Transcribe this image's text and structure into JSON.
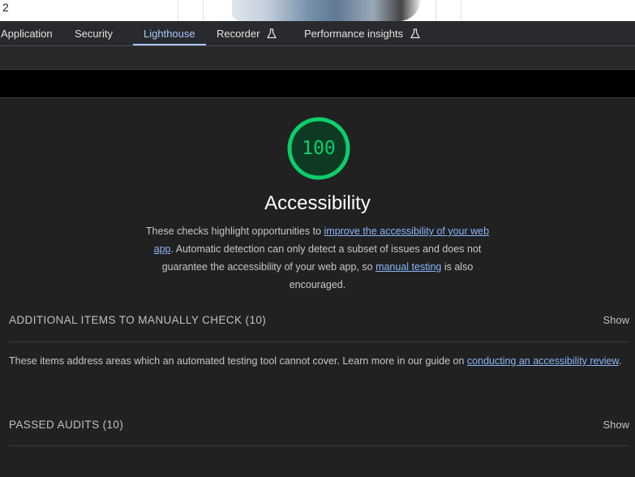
{
  "page": {
    "row_number": "2"
  },
  "tabs": [
    {
      "label": "Application"
    },
    {
      "label": "Security"
    },
    {
      "label": "Lighthouse"
    },
    {
      "label": "Recorder"
    },
    {
      "label": "Performance insights"
    }
  ],
  "active_tab": "Lighthouse",
  "report": {
    "score": "100",
    "score_fraction": 1.0,
    "score_color": "#0cce6b",
    "category_title": "Accessibility",
    "description": {
      "text1": "These checks highlight opportunities to ",
      "link1": "improve the accessibility of your web app",
      "text2": ". Automatic detection can only detect a subset of issues and does not guarantee the accessibility of your web app, so ",
      "link2": "manual testing",
      "text3": " is also encouraged."
    },
    "manual_section": {
      "title": "ADDITIONAL ITEMS TO MANUALLY CHECK (10)",
      "toggle": "Show",
      "description_text": "These items address areas which an automated testing tool cannot cover. Learn more in our guide on ",
      "description_link": "conducting an accessibility review",
      "description_end": "."
    },
    "passed_section": {
      "title": "PASSED AUDITS (10)",
      "toggle": "Show"
    }
  }
}
